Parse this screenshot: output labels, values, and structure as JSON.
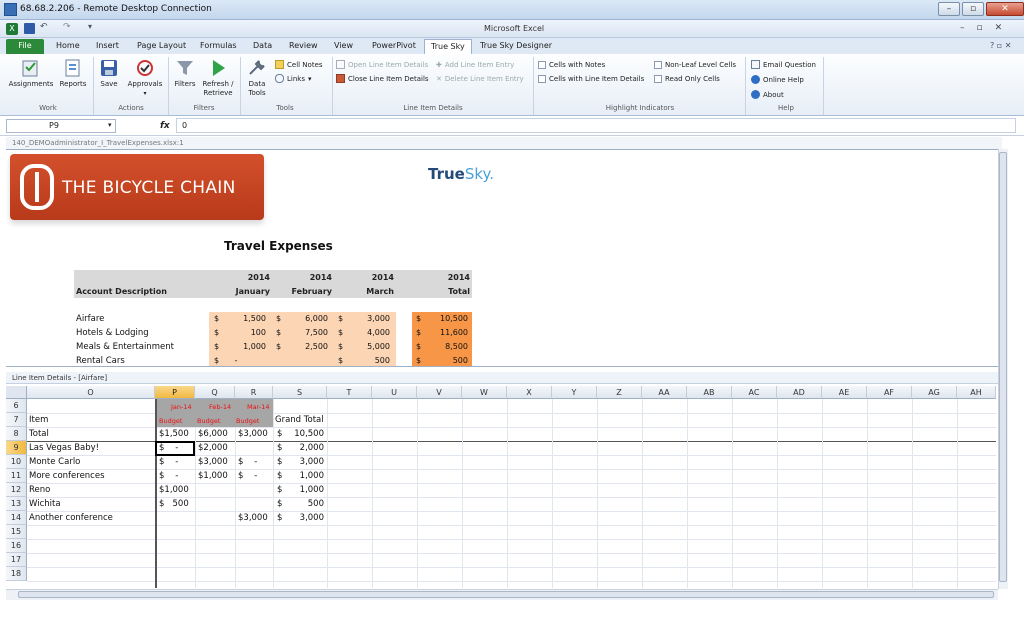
{
  "rdp": {
    "title": "68.68.2.206 - Remote Desktop Connection"
  },
  "excel": {
    "title": "Microsoft Excel"
  },
  "tabs": [
    "File",
    "Home",
    "Insert",
    "Page Layout",
    "Formulas",
    "Data",
    "Review",
    "View",
    "PowerPivot",
    "True Sky",
    "True Sky Designer"
  ],
  "ribbon": {
    "work": {
      "label": "Work",
      "assignments": "Assignments",
      "reports": "Reports"
    },
    "actions": {
      "label": "Actions",
      "save": "Save",
      "approvals": "Approvals"
    },
    "filters": {
      "label": "Filters",
      "filters": "Filters",
      "refresh": "Refresh /",
      "retrieve": "Retrieve"
    },
    "tools": {
      "label": "Tools",
      "data": "Data",
      "tools": "Tools",
      "cell_notes": "Cell Notes",
      "links": "Links"
    },
    "line_item": {
      "label": "Line Item Details",
      "open": "Open Line Item Details",
      "close": "Close Line Item Details",
      "add": "Add Line Item Entry",
      "delete": "Delete Line Item Entry"
    },
    "highlight": {
      "label": "Highlight Indicators",
      "notes": "Cells with Notes",
      "lid": "Cells with Line Item Details",
      "nonleaf": "Non-Leaf Level Cells",
      "readonly": "Read Only Cells"
    },
    "help": {
      "label": "Help",
      "email": "Email Question",
      "online": "Online Help",
      "about": "About"
    }
  },
  "formula": {
    "cell": "P9",
    "fx": "fx",
    "value": "0"
  },
  "workbook": {
    "title": "140_DEMOadministrator_I_TravelExpenses.xlsx:1"
  },
  "report": {
    "logo": "THE BICYCLE CHAIN",
    "truesky_a": "True",
    "truesky_b": "Sky.",
    "title": "Travel Expenses",
    "hdr_year": "2014",
    "hdr_jan": "January",
    "hdr_feb": "February",
    "hdr_mar": "March",
    "hdr_total": "Total",
    "hdr_account": "Account Description",
    "rows": [
      {
        "name": "Airfare",
        "jan": "1,500",
        "feb": "6,000",
        "mar": "3,000",
        "total": "10,500"
      },
      {
        "name": "Hotels & Lodging",
        "jan": "100",
        "feb": "7,500",
        "mar": "4,000",
        "total": "11,600"
      },
      {
        "name": "Meals & Entertainment",
        "jan": "1,000",
        "feb": "2,500",
        "mar": "5,000",
        "total": "8,500"
      },
      {
        "name": "Rental Cars",
        "jan": "-",
        "feb": "",
        "mar": "500",
        "total": "500"
      }
    ],
    "dollar": "$"
  },
  "lid": {
    "label": "Line Item Details - [Airfare]",
    "cols": [
      "O",
      "P",
      "Q",
      "R",
      "S",
      "T",
      "U",
      "V",
      "W",
      "X",
      "Y",
      "Z",
      "AA",
      "AB",
      "AC",
      "AD",
      "AE",
      "AF",
      "AG",
      "AH"
    ],
    "rows": [
      "6",
      "7",
      "8",
      "9",
      "10",
      "11",
      "12",
      "13",
      "14",
      "15",
      "16",
      "17",
      "18"
    ],
    "months": [
      "Jan-14",
      "Feb-14",
      "Mar-14"
    ],
    "budget": "Budget",
    "item": "Item",
    "grand_total": "Grand Total",
    "items": [
      {
        "name": "Total",
        "p": "$1,500",
        "q": "$6,000",
        "r": "$3,000",
        "s": "10,500"
      },
      {
        "name": "Las Vegas Baby!",
        "p": "$    -",
        "q": "$2,000",
        "r": "",
        "s": "2,000"
      },
      {
        "name": "Monte Carlo",
        "p": "$    -",
        "q": "$3,000",
        "r": "$    -",
        "s": "3,000"
      },
      {
        "name": "More conferences",
        "p": "$    -",
        "q": "$1,000",
        "r": "$    -",
        "s": "1,000"
      },
      {
        "name": "Reno",
        "p": "$1,000",
        "q": "",
        "r": "",
        "s": "1,000"
      },
      {
        "name": "Wichita",
        "p": "$   500",
        "q": "",
        "r": "",
        "s": "500"
      },
      {
        "name": "Another conference",
        "p": "",
        "q": "",
        "r": "$3,000",
        "s": "3,000"
      }
    ]
  }
}
